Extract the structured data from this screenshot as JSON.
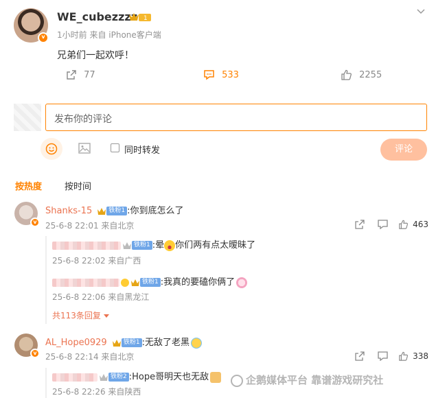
{
  "post": {
    "username": "WE_cubezzzz",
    "meta": "1小时前  来自 iPhone客户端",
    "content": "兄弟们一起欢呼！",
    "repost_count": "77",
    "comment_count": "533",
    "like_count": "2255"
  },
  "composer": {
    "placeholder": "发布你的评论",
    "repost_label": "同时转发",
    "submit_label": "评论"
  },
  "sort_tabs": {
    "hot": "按热度",
    "time": "按时间"
  },
  "comments": [
    {
      "username": "Shanks-15",
      "fan_badge": "铁粉1",
      "text": ":你到底怎么了",
      "time": "25-6-8 22:01 来自北京",
      "likes": "463",
      "replies": [
        {
          "fan_badge": "铁粉1",
          "text_prefix": ":晕",
          "text": "你们两有点太暧昧了",
          "time": "25-6-8 22:02 来自广西"
        },
        {
          "fan_badge": "铁粉1",
          "text": ":我真的要磕你俩了",
          "time": "25-6-8 22:06 来自黑龙江"
        }
      ],
      "more_replies": "共113条回复"
    },
    {
      "username": "AL_Hope0929",
      "fan_badge": "铁粉1",
      "text": ":无敌了老黑",
      "time": "25-6-8 22:14 来自北京",
      "likes": "338",
      "replies": [
        {
          "fan_badge": "铁粉2",
          "text": ":Hope哥明天也无敌",
          "time": "25-6-8 22:26 来自陕西"
        }
      ]
    }
  ],
  "watermark": "企鹅媒体平台 靠谱游戏研究社",
  "icons": [
    "chevron-down-icon",
    "repost-icon",
    "comment-icon",
    "like-icon",
    "emoji-icon",
    "image-icon",
    "checkbox-icon",
    "share-icon",
    "reply-icon",
    "crown-icon"
  ],
  "colors": {
    "accent": "#ff8200",
    "link": "#eb7350",
    "fan_badge": "#6fa6e8",
    "submit_bg": "#ffc09f"
  }
}
